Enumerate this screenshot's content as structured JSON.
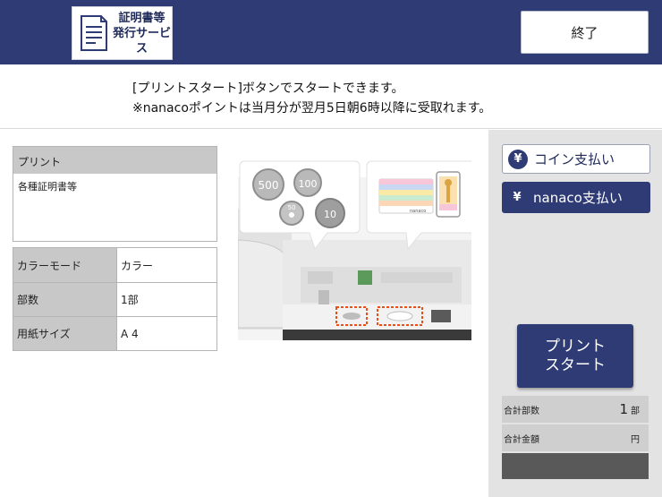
{
  "header": {
    "service_title_line1": "証明書等",
    "service_title_line2": "発行サービス",
    "end_label": "終了"
  },
  "message": {
    "line1": "[プリントスタート]ボタンでスタートできます。",
    "line2": "※nanacoポイントは当月分が翌月5日朝6時以降に受取れます。"
  },
  "print_box": {
    "header": "プリント",
    "body": "各種証明書等"
  },
  "settings": [
    {
      "label": "カラーモード",
      "value": "カラー"
    },
    {
      "label": "部数",
      "value": "1部"
    },
    {
      "label": "用紙サイズ",
      "value": "A 4"
    }
  ],
  "illustration": {
    "coins": [
      "500",
      "100",
      "50",
      "10"
    ],
    "card_brand": "nanaco"
  },
  "payment": {
    "yen_symbol": "¥",
    "coin_label": "コイン支払い",
    "nanaco_label": "nanaco支払い"
  },
  "start_button": {
    "line1": "プリント",
    "line2": "スタート"
  },
  "totals": {
    "copies_label": "合計部数",
    "copies_value": "1",
    "copies_unit": "部",
    "amount_label": "合計金額",
    "amount_value": "",
    "amount_unit": "円"
  },
  "colors": {
    "brand": "#2f3b75",
    "highlight": "#e8501a"
  }
}
